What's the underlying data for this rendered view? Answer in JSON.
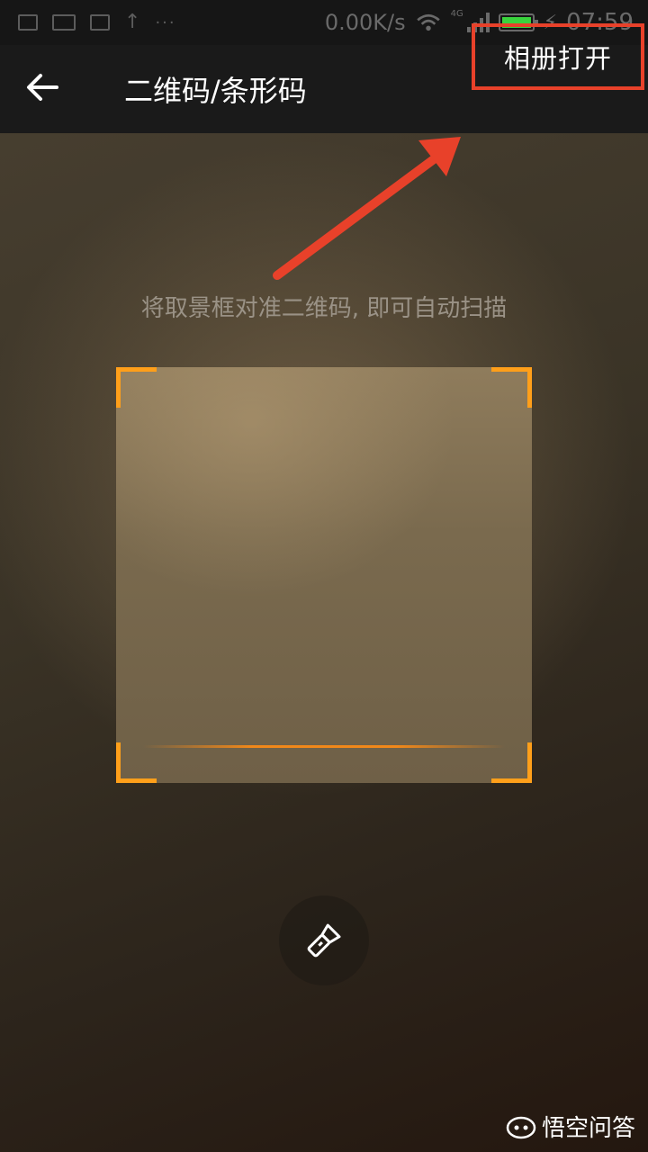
{
  "status_bar": {
    "net_speed": "0.00K/s",
    "network_badge": "4G",
    "time": "07:59",
    "battery_color": "#39d33d",
    "icons": [
      "image-icon",
      "sim-icon",
      "calendar-icon",
      "upload-icon",
      "more-icon",
      "wifi-icon",
      "signal-icon",
      "battery-icon",
      "charging-icon"
    ]
  },
  "header": {
    "back_icon": "back-arrow-icon",
    "title": "二维码/条形码",
    "album_button": "相册打开",
    "highlight_color": "#e8412a"
  },
  "scanner": {
    "hint": "将取景框对准二维码, 即可自动扫描",
    "corner_color": "#ff9f1a"
  },
  "flashlight": {
    "icon": "flashlight-icon"
  },
  "watermark": {
    "text": "悟空问答",
    "icon": "wukong-logo-icon"
  }
}
